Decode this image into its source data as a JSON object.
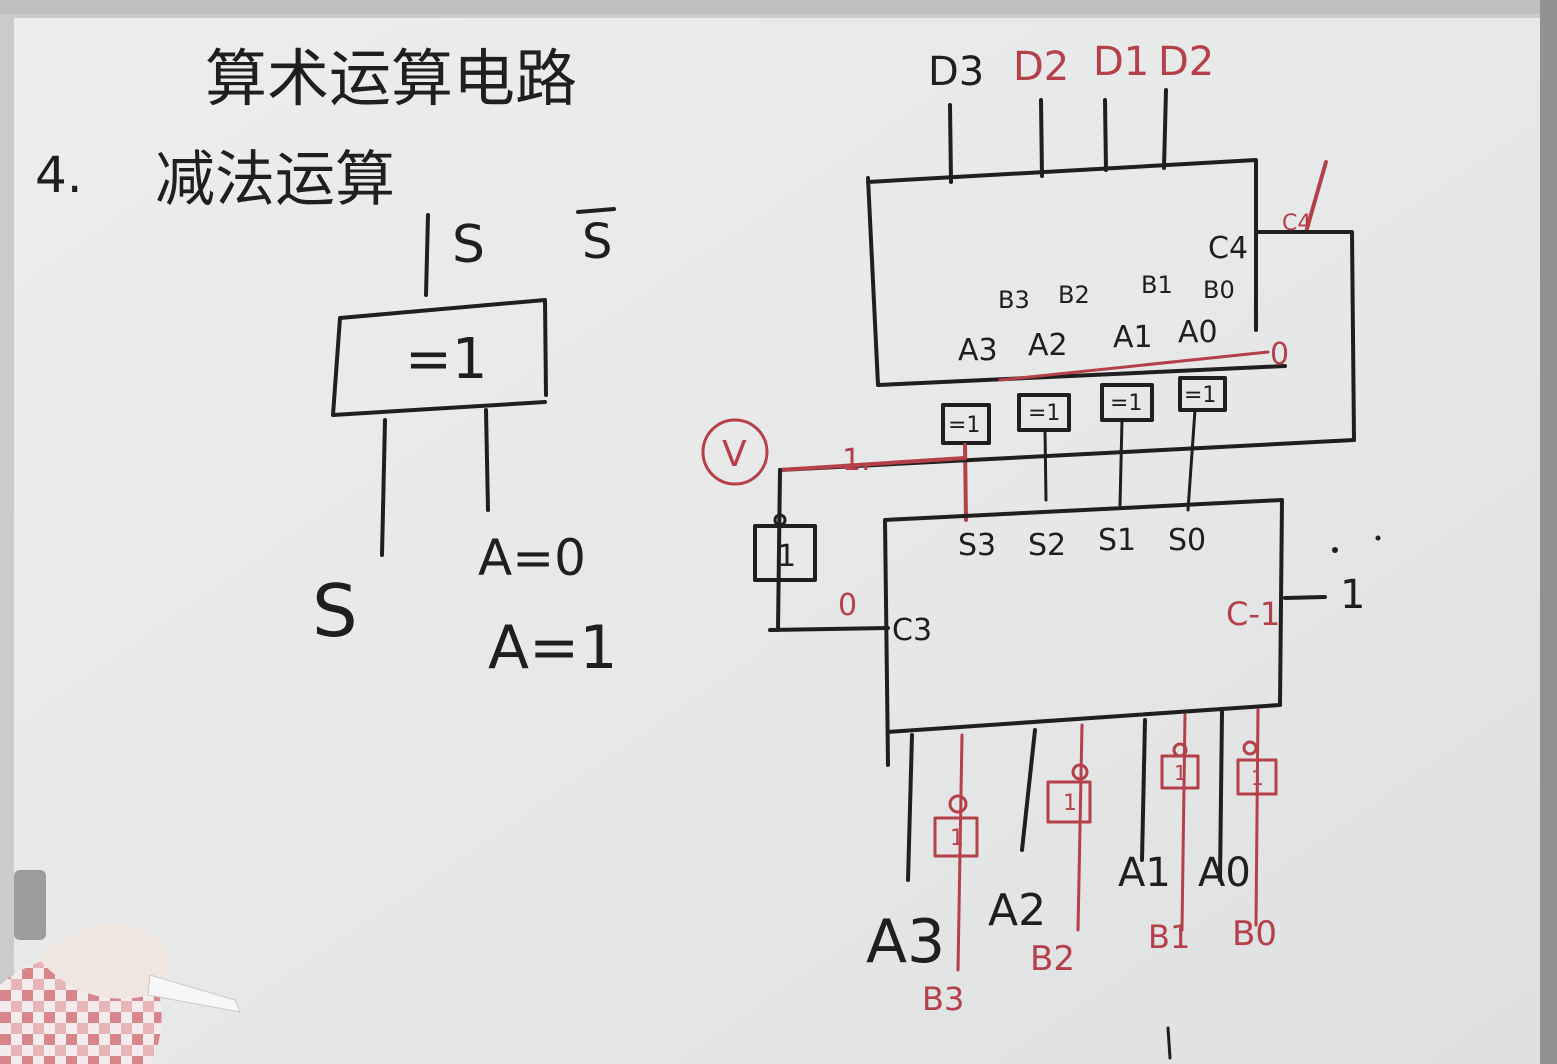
{
  "board": {
    "title": "算术运算电路",
    "section_number": "4.",
    "section_title": "减法运算",
    "xor_demo": {
      "out_s": "S",
      "out_s_bar": "S",
      "gate_label": "=1",
      "input_s": "S",
      "a_zero": "A=0",
      "a_one": "A=1"
    },
    "upper_adder": {
      "outputs": [
        "D3",
        "D2",
        "D1",
        "D2"
      ],
      "carry_out": "C4",
      "carry_out_red": "C4",
      "b_inputs": [
        "B3",
        "B2",
        "B1",
        "B0"
      ],
      "a_inputs": [
        "A3",
        "A2",
        "A1",
        "A0"
      ],
      "carry_in": "0"
    },
    "xor_gates": [
      "=1",
      "=1",
      "=1",
      "=1"
    ],
    "sign_circle": "V",
    "sign_line_label": "1.",
    "not_gate": "1",
    "c3_value": "0",
    "lower_adder": {
      "sums": [
        "S3",
        "S2",
        "S1",
        "S0"
      ],
      "carry_out": "C3",
      "carry_in": "C-1",
      "carry_in_value": "1"
    },
    "input_not_gates": [
      "1",
      "1",
      "1",
      "1"
    ],
    "inputs_a": [
      "A3",
      "A2",
      "A1",
      "A0"
    ],
    "inputs_b": [
      "B3",
      "B2",
      "B1",
      "B0"
    ],
    "colors": {
      "board": "#e8e9e8",
      "ink_black": "#1f1f1f",
      "ink_red": "#b5404a"
    }
  }
}
